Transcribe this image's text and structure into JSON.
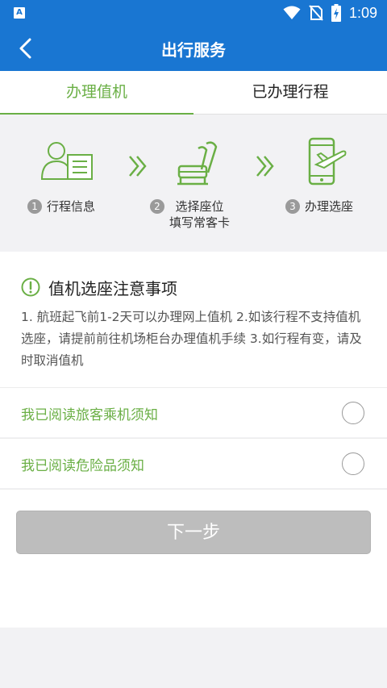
{
  "status_bar": {
    "app_badge": "A",
    "time": "1:09",
    "icons": [
      "wifi-icon",
      "no-sim-icon",
      "battery-charging-icon"
    ]
  },
  "header": {
    "title": "出行服务",
    "back_icon": "chevron-left-icon"
  },
  "tabs": [
    {
      "label": "办理值机",
      "active": true
    },
    {
      "label": "已办理行程",
      "active": false
    }
  ],
  "steps": [
    {
      "number": "1",
      "label": "行程信息",
      "icon": "passenger-id-card-icon"
    },
    {
      "number": "2",
      "label_line1": "选择座位",
      "label_line2": "填写常客卡",
      "icon": "seat-icon"
    },
    {
      "number": "3",
      "label": "办理选座",
      "icon": "phone-plane-icon"
    }
  ],
  "notice": {
    "title": "值机选座注意事项",
    "icon": "exclamation-circle-icon",
    "body": "1. 航班起飞前1-2天可以办理网上值机 2.如该行程不支持值机选座，请提前前往机场柜台办理值机手续 3.如行程有变，请及时取消值机"
  },
  "agreements": [
    {
      "label": "我已阅读旅客乘机须知",
      "checked": false
    },
    {
      "label": "我已阅读危险品须知",
      "checked": false
    }
  ],
  "next_button": {
    "label": "下一步",
    "enabled": false
  },
  "colors": {
    "primary_blue": "#1976d2",
    "accent_green": "#6aaf45",
    "disabled_gray": "#bdbdbd"
  }
}
